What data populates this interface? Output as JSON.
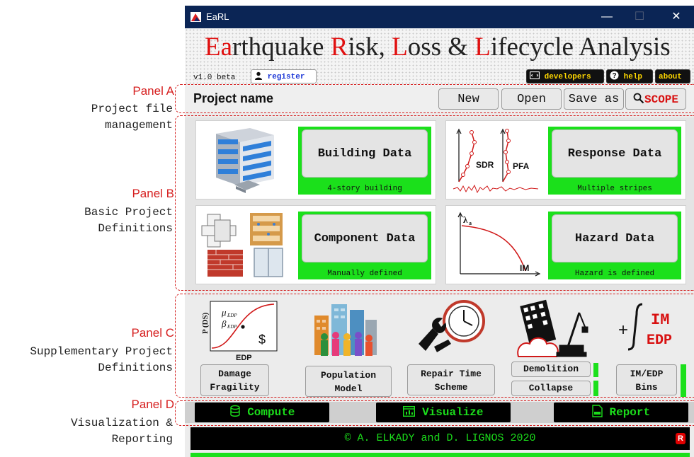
{
  "annotations": [
    {
      "tag": "Panel A",
      "desc": [
        "Project file",
        "management"
      ]
    },
    {
      "tag": "Panel B",
      "desc": [
        "Basic Project",
        "Definitions"
      ]
    },
    {
      "tag": "Panel C",
      "desc": [
        "Supplementary Project",
        "Definitions"
      ]
    },
    {
      "tag": "Panel D",
      "desc": [
        "Visualization &",
        "Reporting"
      ]
    }
  ],
  "window": {
    "title": "EaRL",
    "minimize": "—",
    "maximize": "☐",
    "close": "✕"
  },
  "header": {
    "title_parts": [
      {
        "text": "Ea",
        "red": true
      },
      {
        "text": "rthquake ",
        "red": false
      },
      {
        "text": "R",
        "red": true
      },
      {
        "text": "isk, ",
        "red": false
      },
      {
        "text": "L",
        "red": true
      },
      {
        "text": "oss & ",
        "red": false
      },
      {
        "text": "L",
        "red": true
      },
      {
        "text": "ifecycle Analysis",
        "red": false
      }
    ],
    "version": "v1.0 beta",
    "register": "register",
    "developers": "developers",
    "help": "help",
    "about": "about"
  },
  "panelA": {
    "project_name": "Project name",
    "new": "New",
    "open": "Open",
    "save_as": "Save as",
    "scope": "SCOPE"
  },
  "panelB": {
    "building": {
      "label": "Building Data",
      "status": "4-story building"
    },
    "response": {
      "label": "Response Data",
      "status": "Multiple stripes",
      "sdr": "SDR",
      "pfa": "PFA"
    },
    "component": {
      "label": "Component Data",
      "status": "Manually defined"
    },
    "hazard": {
      "label": "Hazard Data",
      "status": "Hazard is defined",
      "lambda": "λ",
      "lambda_sub": "a",
      "im": "IM"
    }
  },
  "panelC": {
    "fragility": {
      "line1": "Damage",
      "line2": "Fragility",
      "pds": "P (DS)",
      "mu": "μ",
      "beta": "β",
      "sub": "EDP",
      "xlabel": "EDP",
      "dollar": "$"
    },
    "population": {
      "line1": "Population",
      "line2": "Model"
    },
    "repair": {
      "line1": "Repair Time",
      "line2": "Scheme"
    },
    "demolition": "Demolition",
    "collapse": "Collapse",
    "bins": {
      "line1": "IM/EDP",
      "line2": "Bins",
      "im": "IM",
      "edp": "EDP",
      "plus": "+"
    }
  },
  "panelD": {
    "compute": "Compute",
    "visualize": "Visualize",
    "report": "Report"
  },
  "footer": {
    "text": "© A. ELKADY and D. LIGNOS 2020",
    "badge": "R"
  },
  "colors": {
    "accent_red": "#e01010",
    "status_green": "#1be01b",
    "titlebar": "#0b2555",
    "annotation_red": "#d42020"
  }
}
